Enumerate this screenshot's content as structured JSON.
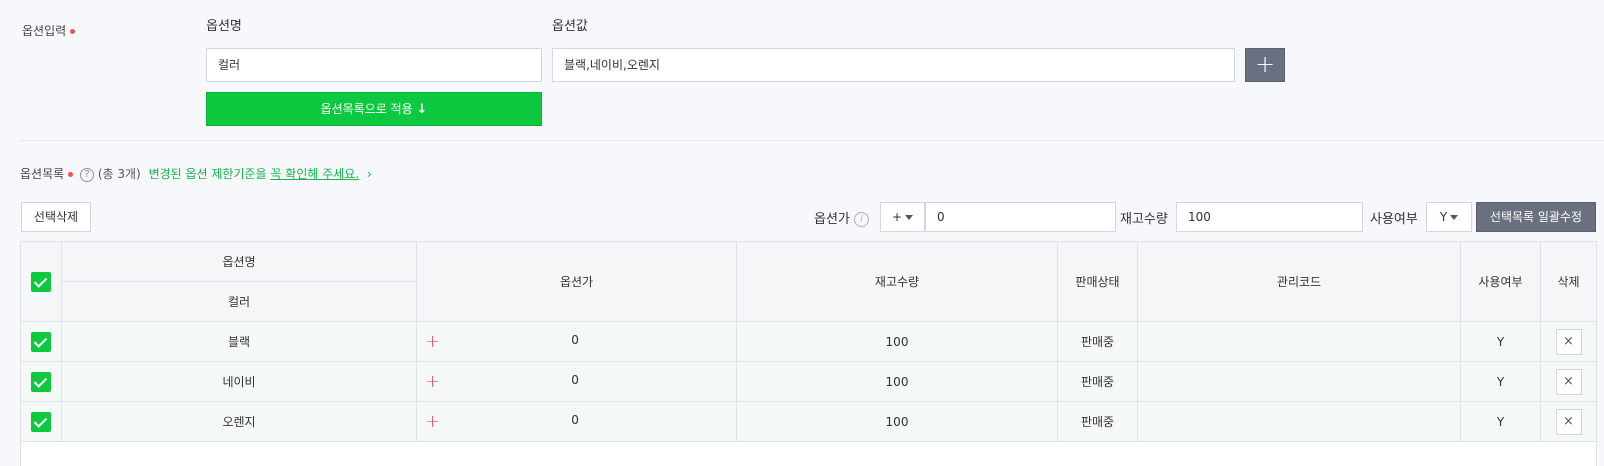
{
  "option_input": {
    "label": "옵션입력",
    "name_header": "옵션명",
    "value_header": "옵션값",
    "name_value": "컬러",
    "value_value": "블랙,네이비,오렌지",
    "add_button": "+",
    "apply_button": "옵션목록으로 적용"
  },
  "option_list": {
    "label": "옵션목록",
    "help": "?",
    "count_text": "(총 3개)",
    "notice_prefix": "변경된 옵션 제한기준을",
    "notice_link": "꼭 확인해 주세요.",
    "notice_arrow": "›"
  },
  "toolbar": {
    "delete_selected": "선택삭제",
    "price_label": "옵션가",
    "price_info": "i",
    "price_sign": "+",
    "price_value": "0",
    "stock_label": "재고수량",
    "stock_value": "100",
    "usage_label": "사용여부",
    "usage_value": "Y",
    "bulk_edit": "선택목록 일괄수정"
  },
  "table": {
    "headers": {
      "option_name": "옵션명",
      "option_sub": "컬러",
      "price": "옵션가",
      "stock": "재고수량",
      "status": "판매상태",
      "code": "관리코드",
      "usage": "사용여부",
      "delete": "삭제"
    },
    "rows": [
      {
        "name": "블랙",
        "price_sign": "+",
        "price": "0",
        "stock": "100",
        "status": "판매중",
        "code": "",
        "usage": "Y",
        "delete": "×"
      },
      {
        "name": "네이비",
        "price_sign": "+",
        "price": "0",
        "stock": "100",
        "status": "판매중",
        "code": "",
        "usage": "Y",
        "delete": "×"
      },
      {
        "name": "오렌지",
        "price_sign": "+",
        "price": "0",
        "stock": "100",
        "status": "판매중",
        "code": "",
        "usage": "Y",
        "delete": "×"
      }
    ]
  },
  "colors": {
    "accent_green": "#0cc940",
    "required_dot": "#f0524e",
    "plus_red": "#e8525a",
    "dark_button": "#69707f"
  }
}
